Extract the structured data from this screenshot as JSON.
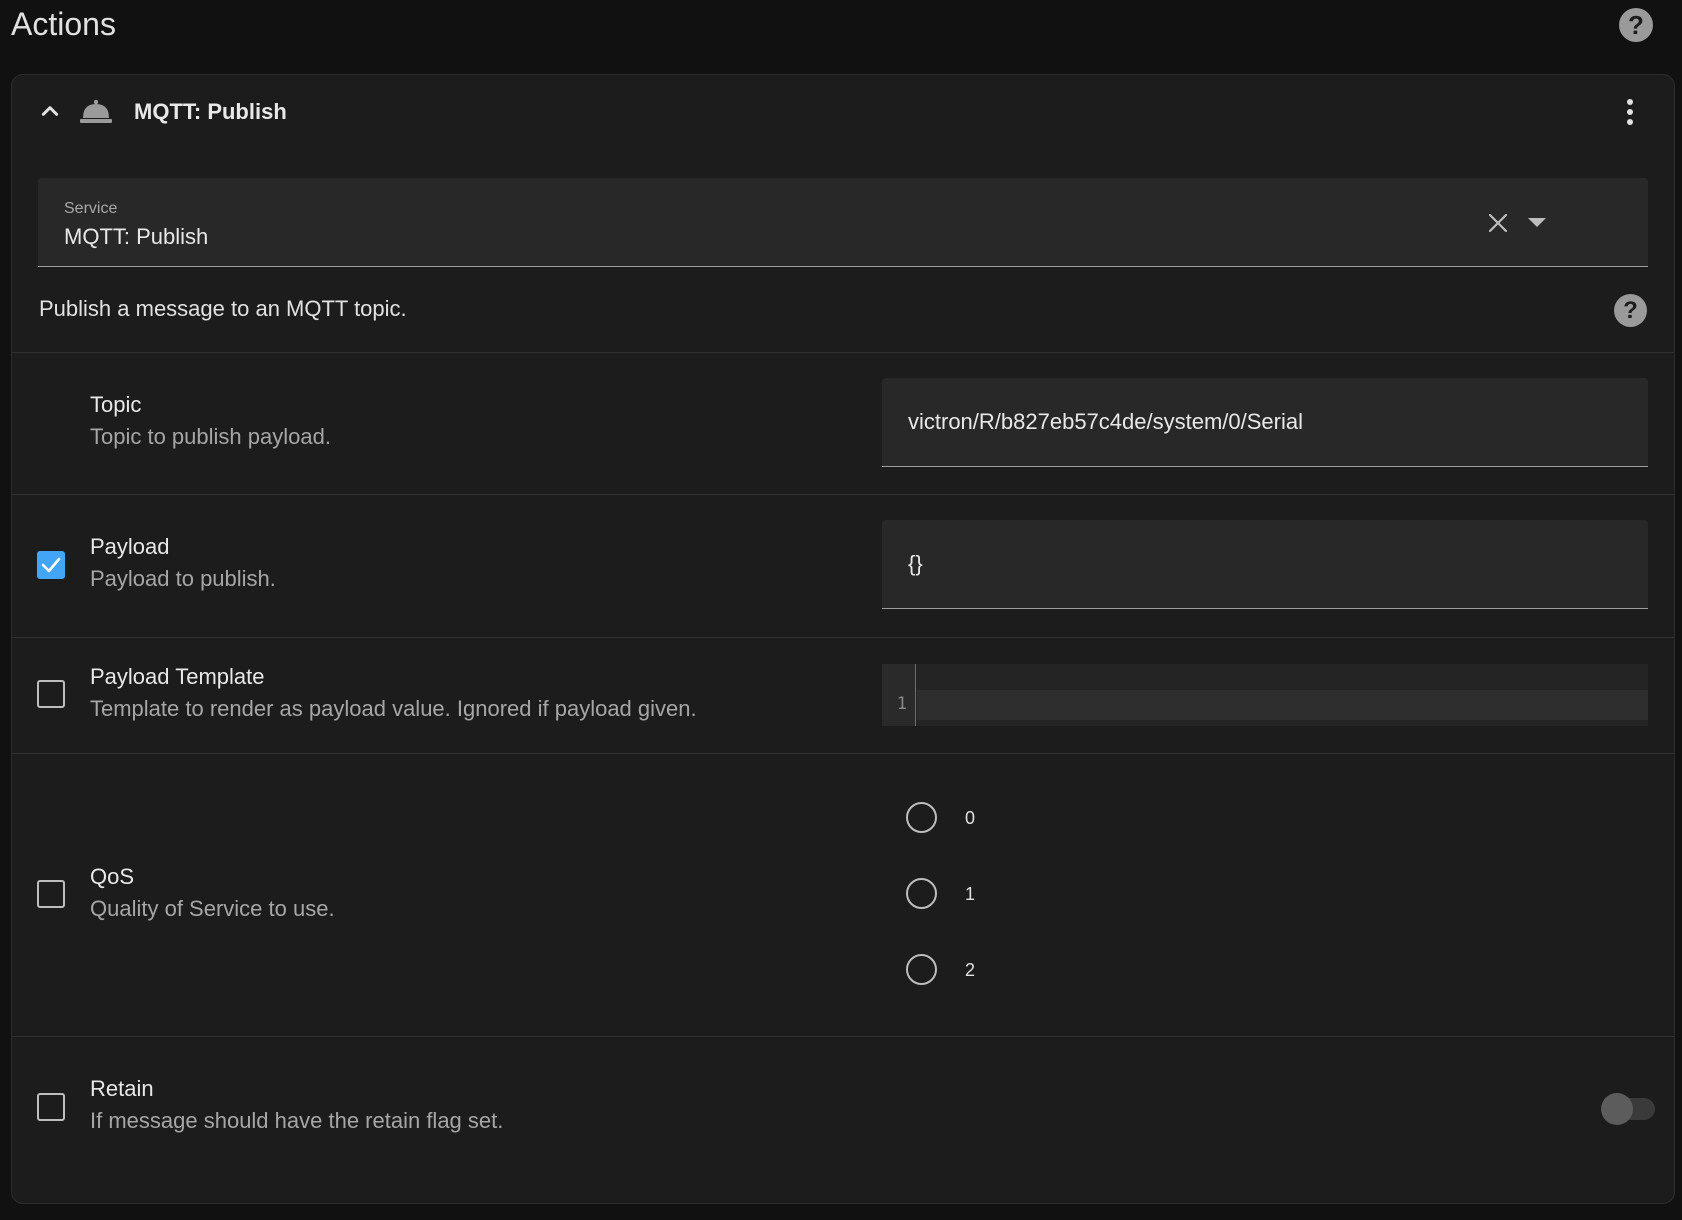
{
  "page": {
    "title": "Actions",
    "help_icon": "help-circle-icon"
  },
  "action": {
    "title": "MQTT: Publish",
    "collapse_icon": "chevron-up-icon",
    "service_icon": "bell-icon",
    "menu_icon": "dots-vertical-icon",
    "service_field": {
      "label": "Service",
      "value": "MQTT: Publish",
      "clear_icon": "close-icon",
      "dropdown_icon": "menu-down-icon"
    },
    "description": "Publish a message to an MQTT topic.",
    "fields": [
      {
        "title": "Topic",
        "description": "Topic to publish payload.",
        "value": "victron/R/b827eb57c4de/system/0/Serial"
      },
      {
        "title": "Payload",
        "description": "Payload to publish.",
        "checked": true,
        "value": "{}"
      },
      {
        "title": "Payload Template",
        "description": "Template to render as payload value. Ignored if payload given.",
        "checked": false,
        "line_number": "1",
        "value": ""
      },
      {
        "title": "QoS",
        "description": "Quality of Service to use.",
        "checked": false,
        "options": [
          "0",
          "1",
          "2"
        ],
        "selected": null
      },
      {
        "title": "Retain",
        "description": "If message should have the retain flag set.",
        "checked": false,
        "toggle_on": false
      }
    ]
  },
  "colors": {
    "background": "#111111",
    "card": "#1c1c1c",
    "input": "#282828",
    "accent": "#42a5f5",
    "text_primary": "#e1e1e1",
    "text_secondary": "#a6a6a6"
  }
}
